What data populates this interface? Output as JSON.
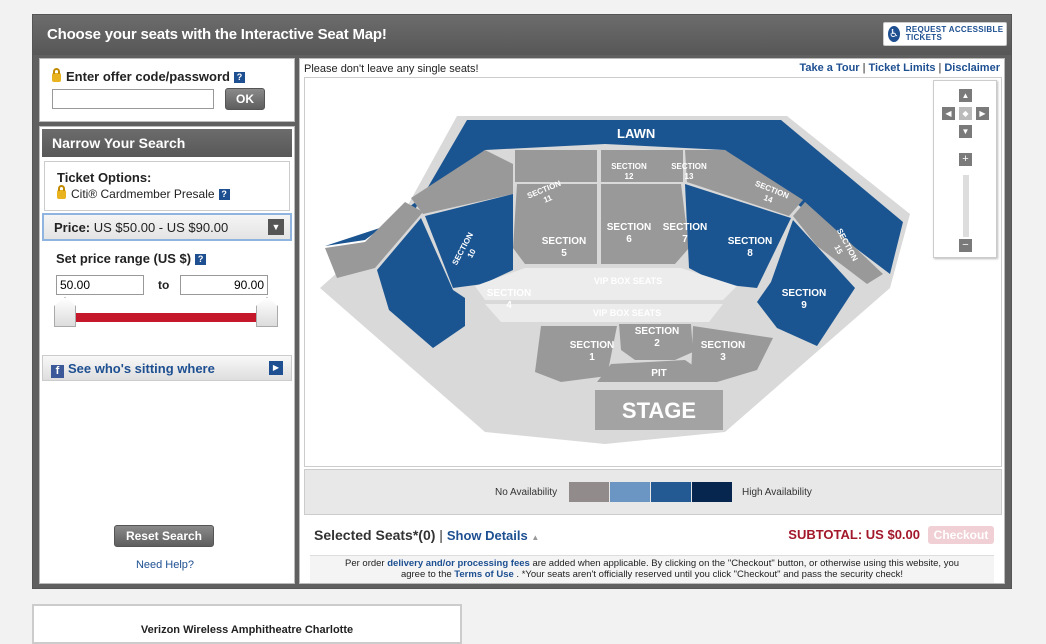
{
  "header": {
    "title": "Choose your seats with the Interactive Seat Map!",
    "accessible_btn": "REQUEST ACCESSIBLE TICKETS"
  },
  "offer": {
    "label": "Enter offer code/password",
    "input_value": "",
    "ok_label": "OK"
  },
  "narrow": {
    "title": "Narrow Your Search",
    "ticket_options_label": "Ticket Options:",
    "ticket_option_value": "Citi® Cardmember Presale",
    "price_label": "Price:",
    "price_value": "US $50.00 - US $90.00",
    "range_label": "Set price range (US $)",
    "range_from": "50.00",
    "range_to_label": "to",
    "range_to": "90.00",
    "fb_label": "See who's sitting where",
    "reset_label": "Reset Search",
    "help_label": "Need Help?"
  },
  "top": {
    "notice": "Please don't leave any single seats!",
    "links": [
      "Take a Tour",
      "Ticket Limits",
      "Disclaimer"
    ]
  },
  "map": {
    "colors": {
      "dark_blue": "#1b5591",
      "grey_section": "#999999",
      "grey_light": "#d9d9d9",
      "stage": "#a3a3a3"
    },
    "lawn": "LAWN",
    "stage": "STAGE",
    "pit": "PIT",
    "vip1": "VIP BOX SEATS",
    "vip2": "VIP BOX SEATS",
    "sections": {
      "s1": [
        "SECTION",
        "1"
      ],
      "s2": [
        "SECTION",
        "2"
      ],
      "s3": [
        "SECTION",
        "3"
      ],
      "s4": [
        "SECTION",
        "4"
      ],
      "s5": [
        "SECTION",
        "5"
      ],
      "s6": [
        "SECTION",
        "6"
      ],
      "s7": [
        "SECTION",
        "7"
      ],
      "s8": [
        "SECTION",
        "8"
      ],
      "s9": [
        "SECTION",
        "9"
      ],
      "s10": [
        "SECTION",
        "10"
      ],
      "s11": [
        "SECTION",
        "11"
      ],
      "s12": [
        "SECTION",
        "12"
      ],
      "s13": [
        "SECTION",
        "13"
      ],
      "s14": [
        "SECTION",
        "14"
      ],
      "s15": [
        "SECTION",
        "15"
      ]
    }
  },
  "legend": {
    "low": "No Availability",
    "high": "High Availability",
    "swatches": [
      "#918b8b",
      "#6b96c4",
      "#245a93",
      "#07264f"
    ]
  },
  "footer": {
    "selected": "Selected Seats*(0)",
    "show_details": "Show Details",
    "subtotal": "SUBTOTAL: US $0.00",
    "checkout": "Checkout",
    "fine_1a": "Per order",
    "fine_1b": "delivery and/or processing fees",
    "fine_1c": "are added when applicable. By clicking on the \"Checkout\" button, or otherwise using this website, you",
    "fine_2a": "agree to the",
    "fine_2b": "Terms of Use",
    "fine_2c": ". *Your seats aren't officially reserved until you click \"Checkout\" and pass the security check!"
  },
  "venue": {
    "name": "Verizon Wireless Amphitheatre Charlotte"
  }
}
